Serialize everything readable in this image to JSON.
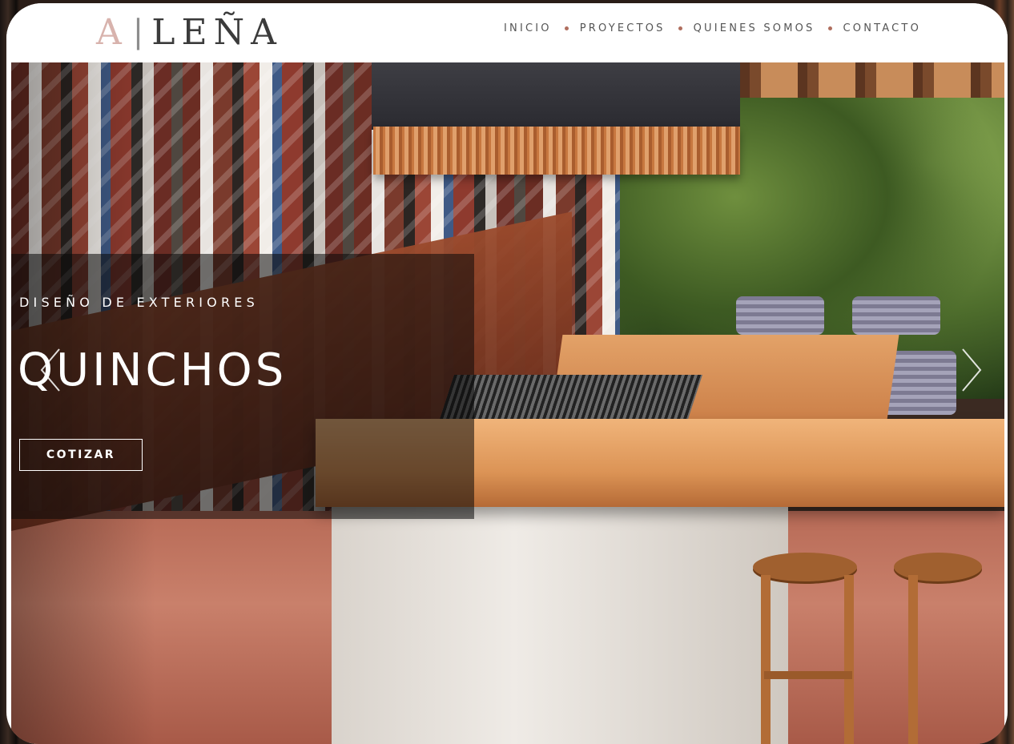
{
  "header": {
    "logo": {
      "a": "A",
      "separator": "|",
      "rest": "LEÑA"
    },
    "nav": [
      {
        "label": "INICIO"
      },
      {
        "label": "PROYECTOS"
      },
      {
        "label": "QUIENES SOMOS"
      },
      {
        "label": "CONTACTO"
      }
    ]
  },
  "hero": {
    "eyebrow": "DISEÑO DE EXTERIORES",
    "title": "QUINCHOS",
    "cta_label": "COTIZAR",
    "prev_icon": "chevron-left-icon",
    "next_icon": "chevron-right-icon"
  },
  "colors": {
    "logo_accent": "#d8b3ad",
    "nav_dot": "#b06e5e",
    "text_dark": "#3b3b3b"
  }
}
